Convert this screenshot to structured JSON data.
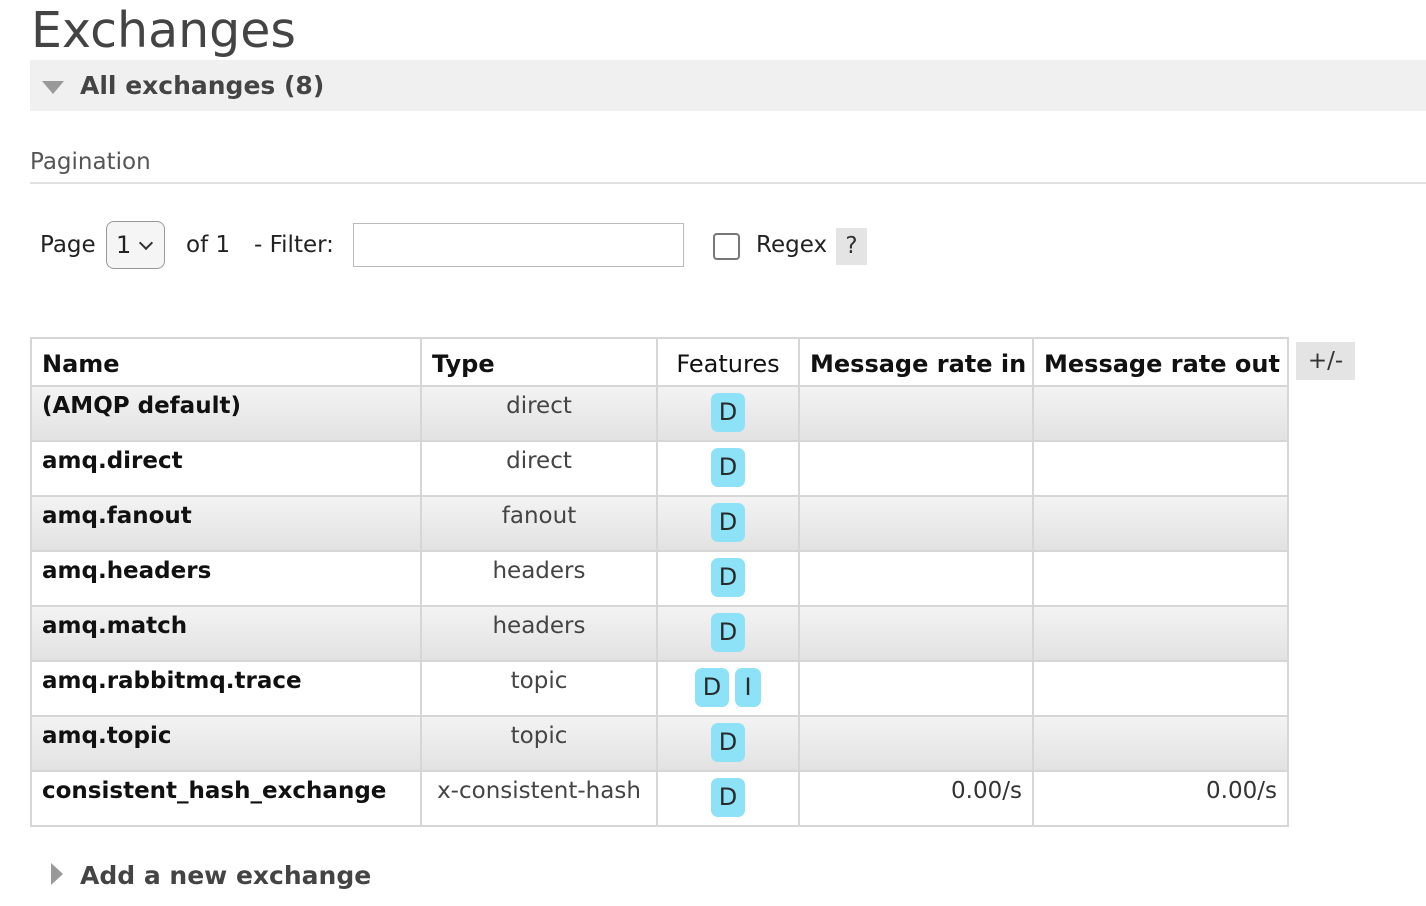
{
  "page": {
    "title": "Exchanges"
  },
  "section": {
    "title": "All exchanges (8)"
  },
  "pagination": {
    "label": "Pagination",
    "page_label": "Page",
    "page_value": "1",
    "of_label": "of 1",
    "filter_label": "- Filter:",
    "filter_value": "",
    "regex_label": "Regex",
    "regex_checked": false,
    "help_label": "?"
  },
  "table": {
    "columns": [
      "Name",
      "Type",
      "Features",
      "Message rate in",
      "Message rate out"
    ],
    "toggle_label": "+/-",
    "rows": [
      {
        "name": "(AMQP default)",
        "type": "direct",
        "features": [
          "D"
        ],
        "rate_in": "",
        "rate_out": ""
      },
      {
        "name": "amq.direct",
        "type": "direct",
        "features": [
          "D"
        ],
        "rate_in": "",
        "rate_out": ""
      },
      {
        "name": "amq.fanout",
        "type": "fanout",
        "features": [
          "D"
        ],
        "rate_in": "",
        "rate_out": ""
      },
      {
        "name": "amq.headers",
        "type": "headers",
        "features": [
          "D"
        ],
        "rate_in": "",
        "rate_out": ""
      },
      {
        "name": "amq.match",
        "type": "headers",
        "features": [
          "D"
        ],
        "rate_in": "",
        "rate_out": ""
      },
      {
        "name": "amq.rabbitmq.trace",
        "type": "topic",
        "features": [
          "D",
          "I"
        ],
        "rate_in": "",
        "rate_out": ""
      },
      {
        "name": "amq.topic",
        "type": "topic",
        "features": [
          "D"
        ],
        "rate_in": "",
        "rate_out": ""
      },
      {
        "name": "consistent_hash_exchange",
        "type": "x-consistent-hash",
        "features": [
          "D"
        ],
        "rate_in": "0.00/s",
        "rate_out": "0.00/s"
      }
    ]
  },
  "add_section": {
    "title": "Add a new exchange"
  },
  "colors": {
    "feature_badge": "#8de2f7",
    "header_bg": "#f0f0f0"
  }
}
